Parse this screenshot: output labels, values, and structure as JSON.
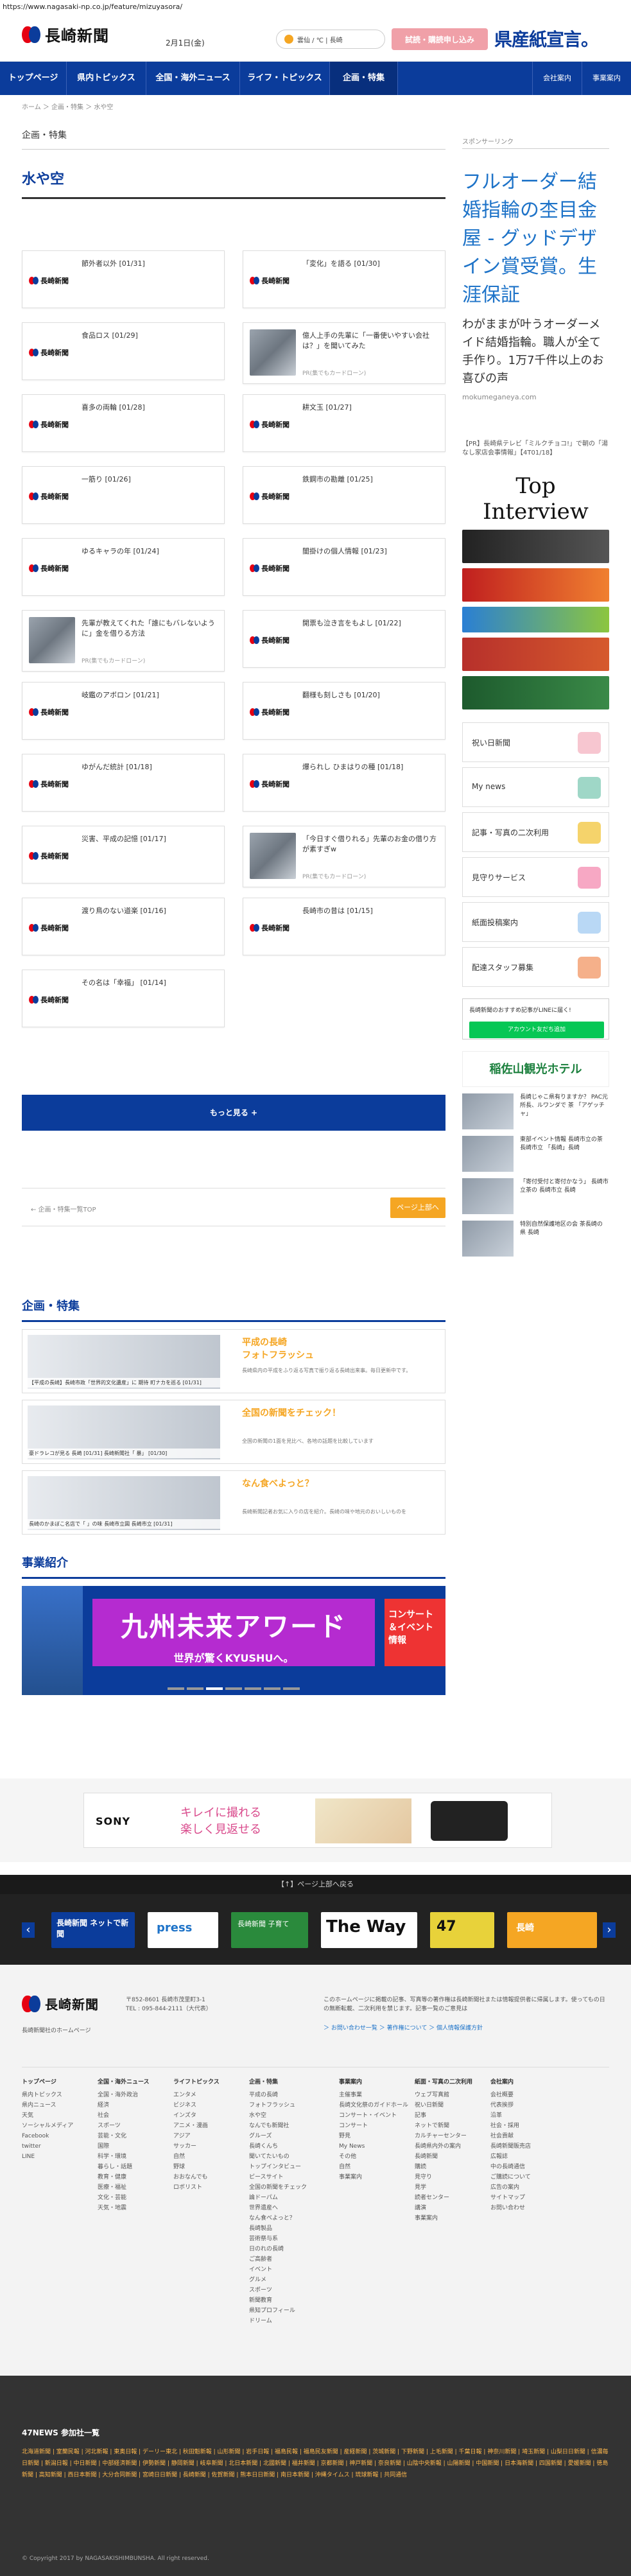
{
  "url": "https://www.nagasaki-np.co.jp/feature/mizuyasora/",
  "header": {
    "logo": "長崎新聞",
    "date": "2月1日(金)",
    "weather": "雲仙 / ℃ | 長崎",
    "trial_button": "試読・購読申し込み",
    "slogan": "県産紙宣言。"
  },
  "nav": {
    "items": [
      "トップページ",
      "県内トピックス",
      "全国・海外ニュース",
      "ライフ・トピックス",
      "企画・特集"
    ],
    "right": [
      "会社案内",
      "事業案内"
    ]
  },
  "breadcrumb": "ホーム ＞ 企画・特集 ＞ 水や空",
  "main": {
    "section_label": "企画・特集",
    "title": "水や空"
  },
  "cards": [
    {
      "title": "節外者以外 [01/31]",
      "type": "logo"
    },
    {
      "title": "「変化」を語る [01/30]",
      "type": "logo"
    },
    {
      "title": "食品ロス [01/29]",
      "type": "logo"
    },
    {
      "title": "億人上手の先輩に「一番使いやすい会社は？」を聞いてみた",
      "type": "photo",
      "pr": "PR(集でもカードローン)"
    },
    {
      "title": "喜多の両輪 [01/28]",
      "type": "logo"
    },
    {
      "title": "耕文玉 [01/27]",
      "type": "logo"
    },
    {
      "title": "一筋り [01/26]",
      "type": "logo"
    },
    {
      "title": "鉄鋼市の勘離 [01/25]",
      "type": "logo"
    },
    {
      "title": "ゆるキャラの年 [01/24]",
      "type": "logo"
    },
    {
      "title": "闇掛けの個人情報 [01/23]",
      "type": "logo"
    },
    {
      "title": "先輩が教えてくれた「誰にもバレないように」金を借りる方法",
      "type": "photo",
      "pr": "PR(集でもカードローン)"
    },
    {
      "title": "開票も泣き言をもよし [01/22]",
      "type": "logo"
    },
    {
      "title": "岐鑑のアボロン [01/21]",
      "type": "logo"
    },
    {
      "title": "翻様も刻しさも [01/20]",
      "type": "logo"
    },
    {
      "title": "ゆがんだ統計 [01/18]",
      "type": "logo"
    },
    {
      "title": "爆られし ひまはりの種 [01/18]",
      "type": "logo"
    },
    {
      "title": "災害、平成の記憶 [01/17]",
      "type": "logo"
    },
    {
      "title": "「今日すぐ借りれる」先輩のお金の借り方が素すぎw",
      "type": "photo",
      "pr": "PR(集でもカードローン)"
    },
    {
      "title": "渡り鳥のない道楽 [01/16]",
      "type": "logo"
    },
    {
      "title": "長崎市の昔は [01/15]",
      "type": "logo"
    },
    {
      "title": "その名は「幸福」 [01/14]",
      "type": "logo"
    }
  ],
  "more_button": "もっと見る +",
  "pager": {
    "left": "← 企画・特集一覧TOP",
    "top": "ページ上部へ"
  },
  "features": {
    "title": "企画・特集",
    "items": [
      {
        "caption": "【平成の長崎】長崎市政「世界的文化遺産」に 期待 町ナカを巡る [01/31]",
        "title": "平成の長崎\nフォトフラッシュ",
        "desc": "長崎県内の平成をふり返る写真で振り返る長崎出来事。毎日更新中です。"
      },
      {
        "caption": "豪ドラレコが見る 長崎 [01/31] 長崎新聞社「 暴」 [01/30]",
        "title": "全国の新聞をチェック！",
        "desc": "全国の新聞の1面を見比べ、各地の話題を比較しています"
      },
      {
        "caption": "長崎のかまぼこ名店で「 」の味 長崎市立図 長崎市立 [01/31]",
        "title": "なん食べよっと？",
        "desc": "長崎新聞記者お気に入りの店を紹介。長崎の味や地元のおいしいものを"
      }
    ]
  },
  "business": {
    "title": "事業紹介",
    "banner_main": "九州未来アワード",
    "banner_sub": "世界が驚くKYUSHUへ。",
    "banner_right": "コンサート＆イベント情報"
  },
  "side": {
    "label": "スポンサーリンク",
    "ad_text": "フルオーダー結婚指輪の杢目金屋 - グッドデザイン賞受賞。生涯保証",
    "ad_sub": "わがままが叶うオーダーメイド結婚指輪。職人が全て手作り。1万7千件以上のお喜びの声",
    "ad_url": "mokumeganeya.com",
    "note": "【PR】長崎県テレビ「ミルクチョコ!」で朝の「湯なし家店会事情報」【4T01/18】",
    "ti": "Top Interview",
    "boxes": [
      "祝い日新聞",
      "My news",
      "記事・写真の二次利用",
      "見守りサービス",
      "紙面投稿案内",
      "配達スタッフ募集"
    ],
    "line_title": "長崎新聞のおすすめ記事がLINEに届く!",
    "line_btn": "アカウント友だち追加",
    "hotel": "稲佐山観光ホテル",
    "news": [
      "長崎じゃこ県有りますか？ PAC元所長、ルワンダで 茶 「アゲッチャ」",
      "東部イベント情報 長崎市立の茶 長崎市立 「長崎」長崎",
      "「寄付受付と寄付かなう」 長崎市立茶の 長崎市立 長崎",
      "特別自然保護地区の会 茶長崎の 県 長崎"
    ]
  },
  "ad_wide": {
    "brand": "SONY",
    "copy": "キレイに撮れる\n楽しく見返せる"
  },
  "stack_text": "【↑】ページ上部へ戻る",
  "strip": [
    "長崎新聞 ネットで新聞",
    "press",
    "長崎新聞 子育て",
    "The Way",
    "47",
    "長崎"
  ],
  "footer": {
    "address": "〒852-8601 長崎市茂里町3-1\nTEL : 095-844-2111（大代表）",
    "about": "長崎新聞社のホームページ",
    "note": "このホームページに掲載の記事、写真等の著作権は長崎新聞社または情報提供者に帰属します。使ってもの日の無断転載、二次利用を禁じます。記事一覧のご意見は",
    "links": "＞ お問い合わせ一覧  ＞ 著作権について  ＞ 個人情報保護方針",
    "cols": [
      {
        "h": "トップページ",
        "items": [
          "県内トピックス",
          "県内ニュース",
          "天気",
          "ソーシャルメディア",
          "Facebook",
          "twitter",
          "LINE"
        ]
      },
      {
        "h": "全国・海外ニュース",
        "items": [
          "全国・海外政治",
          "経済",
          "社会",
          "スポーツ",
          "芸能・文化",
          "国際",
          "科学・環境",
          "暮らし・話題",
          "教育・健康",
          "医療・福祉",
          "文化・芸能",
          "天気・地震"
        ]
      },
      {
        "h": "ライフトピックス",
        "items": [
          "エンタメ",
          "ビジネス",
          "インズタ",
          "アニメ・漫画",
          "アジア",
          "サッカー",
          "自然",
          "野球",
          "おおなんでも",
          "ロボリスト"
        ]
      },
      {
        "h": "企画・特集",
        "items": [
          "平成の長崎",
          "フォトフラッシュ",
          "水や空",
          "なんでも新聞社",
          "グルーズ",
          "長崎くんち",
          "聞いてたいもの",
          "トップインタビュー",
          "ピースサイト",
          "全国の新聞をチェック",
          "論ドーパム",
          "世界遺産へ",
          "なん食べよっと？",
          "長崎製品",
          "芸術祭与系",
          "日のれの長崎",
          "ご高齢者",
          "イベント",
          "グルメ",
          "スポーツ",
          "新聞教育",
          "県知プロフィール",
          "ドリーム"
        ]
      },
      {
        "h": "事業案内",
        "items": [
          "主催事業",
          "長崎文化祭のガイドホール",
          "コンサート・イベント",
          "コンサート",
          "野見",
          "My News",
          "その他",
          "自然",
          "事業案内"
        ]
      },
      {
        "h": "紙面・写真の二次利用",
        "items": [
          "ウェブ写真館",
          "祝い日新聞",
          "記事",
          "ネットで新聞",
          "カルチャーセンター",
          "長崎県内外の案内",
          "長崎新聞",
          "購読",
          "見守り",
          "見学",
          "読者センター",
          "講演",
          "事業案内"
        ]
      },
      {
        "h": "会社案内",
        "items": [
          "会社概要",
          "代表挨拶",
          "沿革",
          "社会・採用",
          "社会貢献",
          "長崎新聞販売店",
          "広報誌",
          "中の長崎通信",
          "ご購読について",
          "広告の案内",
          "サイトマップ",
          "お問い合わせ"
        ]
      }
    ]
  },
  "bottom": {
    "head": "47NEWS 参加社一覧",
    "links": "北海道新聞 | 室蘭民報 | 河北新報 | 東奥日報 | デーリー東北 | 秋田魁新報 | 山形新聞 | 岩手日報 | 福島民報 | 福島民友新聞 | 産経新聞 | 茨城新聞 | 下野新聞 | 上毛新聞 | 千葉日報 | 神奈川新聞 | 埼玉新聞 | 山梨日日新聞 | 信濃毎日新聞 | 新潟日報 | 中日新聞 | 中部経済新聞 | 伊勢新聞 | 静岡新聞 | 岐阜新聞 | 北日本新聞 | 北國新聞 | 福井新聞 | 京都新聞 | 神戸新聞 | 奈良新聞 | 山陰中央新報 | 山陽新聞 | 中国新聞 | 日本海新聞 | 四国新聞 | 愛媛新聞 | 徳島新聞 | 高知新聞 | 西日本新聞 | 大分合同新聞 | 宮崎日日新聞 | 長崎新聞 | 佐賀新聞 | 熊本日日新聞 | 南日本新聞 | 沖縄タイムス | 琉球新報 | 共同通信",
    "copy": "© Copyright 2017 by NAGASAKISHIMBUNSHA. All right reserved."
  }
}
